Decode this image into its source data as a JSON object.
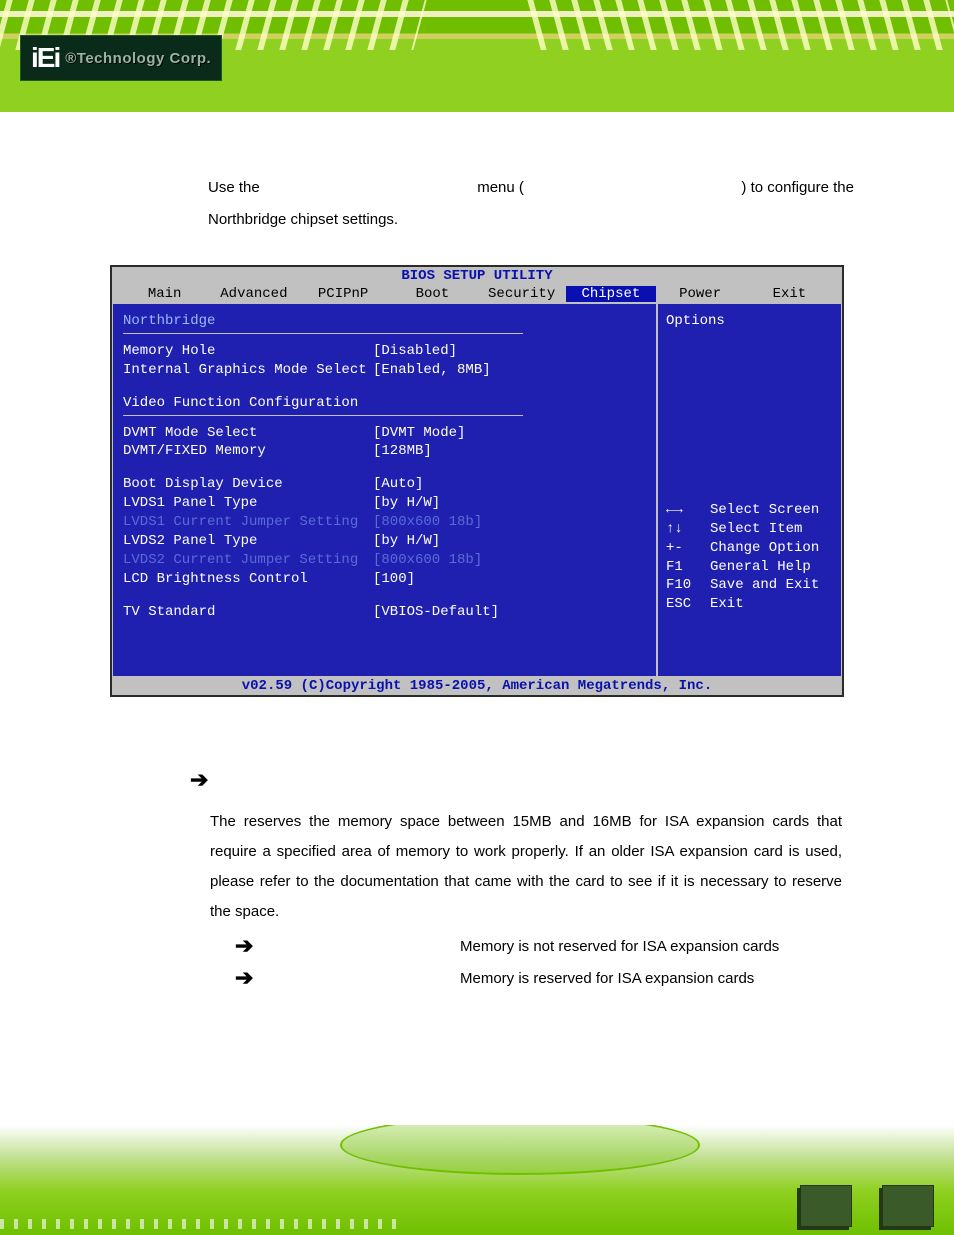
{
  "banner": {
    "logo_mark": "iEi",
    "logo_sub": "®Technology Corp."
  },
  "intro": {
    "l1a": "Use the",
    "l1b": "menu (",
    "l1c": ") to configure the",
    "l2": "Northbridge chipset settings."
  },
  "bios": {
    "title": "BIOS SETUP UTILITY",
    "menu": [
      "Main",
      "Advanced",
      "PCIPnP",
      "Boot",
      "Security",
      "Chipset",
      "Power",
      "Exit"
    ],
    "left": {
      "heading": "Northbridge",
      "rows1": [
        {
          "l": "Memory Hole",
          "v": "[Disabled]"
        },
        {
          "l": "Internal Graphics Mode Select",
          "v": "[Enabled, 8MB]"
        }
      ],
      "subhead": "Video Function Configuration",
      "rows2": [
        {
          "l": "DVMT Mode Select",
          "v": "[DVMT Mode]"
        },
        {
          "l": "  DVMT/FIXED Memory",
          "v": "[128MB]"
        }
      ],
      "rows3": [
        {
          "l": "Boot Display Device",
          "v": "[Auto]"
        },
        {
          "l": "LVDS1 Panel Type",
          "v": "[by H/W]"
        },
        {
          "l": "LVDS1 Current Jumper Setting",
          "v": "[800x600 18b]",
          "dim": true
        },
        {
          "l": "LVDS2 Panel Type",
          "v": "[by H/W]"
        },
        {
          "l": "LVDS2 Current Jumper Setting",
          "v": "[800x600 18b]",
          "dim": true
        },
        {
          "l": "LCD Brightness Control",
          "v": "[100]"
        }
      ],
      "rows4": [
        {
          "l": "TV Standard",
          "v": "[VBIOS-Default]"
        }
      ]
    },
    "right": {
      "title": "Options",
      "keys": [
        {
          "k": "←→",
          "d": "Select Screen"
        },
        {
          "k": "↑↓",
          "d": "Select Item"
        },
        {
          "k": "+-",
          "d": "Change Option"
        },
        {
          "k": "F1",
          "d": "General Help"
        },
        {
          "k": "F10",
          "d": "Save and Exit"
        },
        {
          "k": "ESC",
          "d": "Exit"
        }
      ]
    },
    "footer": "v02.59 (C)Copyright 1985-2005, American Megatrends, Inc."
  },
  "section": {
    "arrow": "➔",
    "body_pre": "The",
    "body_post": " reserves the memory space between 15MB and 16MB for ISA expansion cards that require a specified area of memory to work properly. If an older ISA expansion card is used, please refer to the documentation that came with the card to see if it is necessary to reserve the space.",
    "options": [
      {
        "arrow": "➔",
        "txt": "Memory is not reserved for ISA expansion cards"
      },
      {
        "arrow": "➔",
        "txt": "Memory is reserved for ISA expansion cards"
      }
    ]
  }
}
